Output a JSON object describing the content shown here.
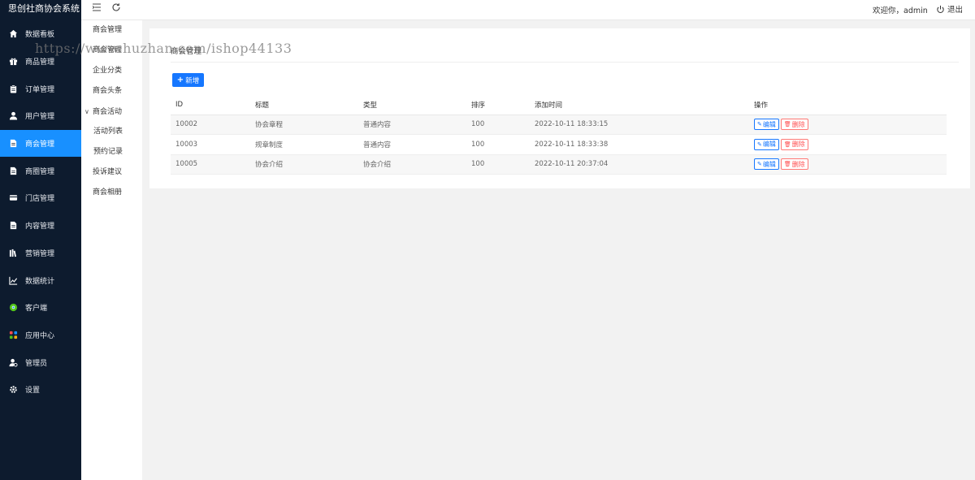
{
  "app": {
    "title": "思创社商协会系统"
  },
  "sidebar": {
    "items": [
      {
        "label": "数据看板",
        "icon": "home-icon"
      },
      {
        "label": "商品管理",
        "icon": "gift-icon"
      },
      {
        "label": "订单管理",
        "icon": "clipboard-icon"
      },
      {
        "label": "用户管理",
        "icon": "user-icon"
      },
      {
        "label": "商会管理",
        "icon": "document-icon",
        "active": true
      },
      {
        "label": "商圈管理",
        "icon": "document-icon"
      },
      {
        "label": "门店管理",
        "icon": "credit-card-icon"
      },
      {
        "label": "内容管理",
        "icon": "document-icon"
      },
      {
        "label": "营销管理",
        "icon": "books-icon"
      },
      {
        "label": "数据统计",
        "icon": "line-chart-icon"
      },
      {
        "label": "客户端",
        "icon": "chrome-icon"
      },
      {
        "label": "应用中心",
        "icon": "apps-icon"
      },
      {
        "label": "管理员",
        "icon": "admin-user-icon"
      },
      {
        "label": "设置",
        "icon": "gear-icon"
      }
    ]
  },
  "submenu": {
    "items": [
      {
        "label": "商会管理",
        "type": "item"
      },
      {
        "label": "商会管理",
        "type": "item"
      },
      {
        "label": "企业分类",
        "type": "item"
      },
      {
        "label": "商会头条",
        "type": "item"
      },
      {
        "label": "商会活动",
        "type": "group"
      },
      {
        "label": "活动列表",
        "type": "child"
      },
      {
        "label": "预约记录",
        "type": "child"
      },
      {
        "label": "投诉建议",
        "type": "item"
      },
      {
        "label": "商会相册",
        "type": "item"
      }
    ]
  },
  "topbar": {
    "welcome": "欢迎你，admin",
    "logout": "退出"
  },
  "watermark": "https://www.huzhan.com/ishop44133",
  "card": {
    "title": "商会管理",
    "add_label": "新增"
  },
  "table": {
    "columns": [
      "ID",
      "标题",
      "类型",
      "排序",
      "添加时间",
      "操作"
    ],
    "rows": [
      {
        "id": "10002",
        "title": "协会章程",
        "type": "普通内容",
        "sort": "100",
        "time": "2022-10-11 18:33:15"
      },
      {
        "id": "10003",
        "title": "规章制度",
        "type": "普通内容",
        "sort": "100",
        "time": "2022-10-11 18:33:38"
      },
      {
        "id": "10005",
        "title": "协会介绍",
        "type": "协会介绍",
        "sort": "100",
        "time": "2022-10-11 20:37:04"
      }
    ],
    "edit_label": "编辑",
    "delete_label": "删除"
  },
  "colors": {
    "sidebar_bg": "#0d1b2e",
    "accent": "#1890ff",
    "danger": "#ff4d4f"
  }
}
